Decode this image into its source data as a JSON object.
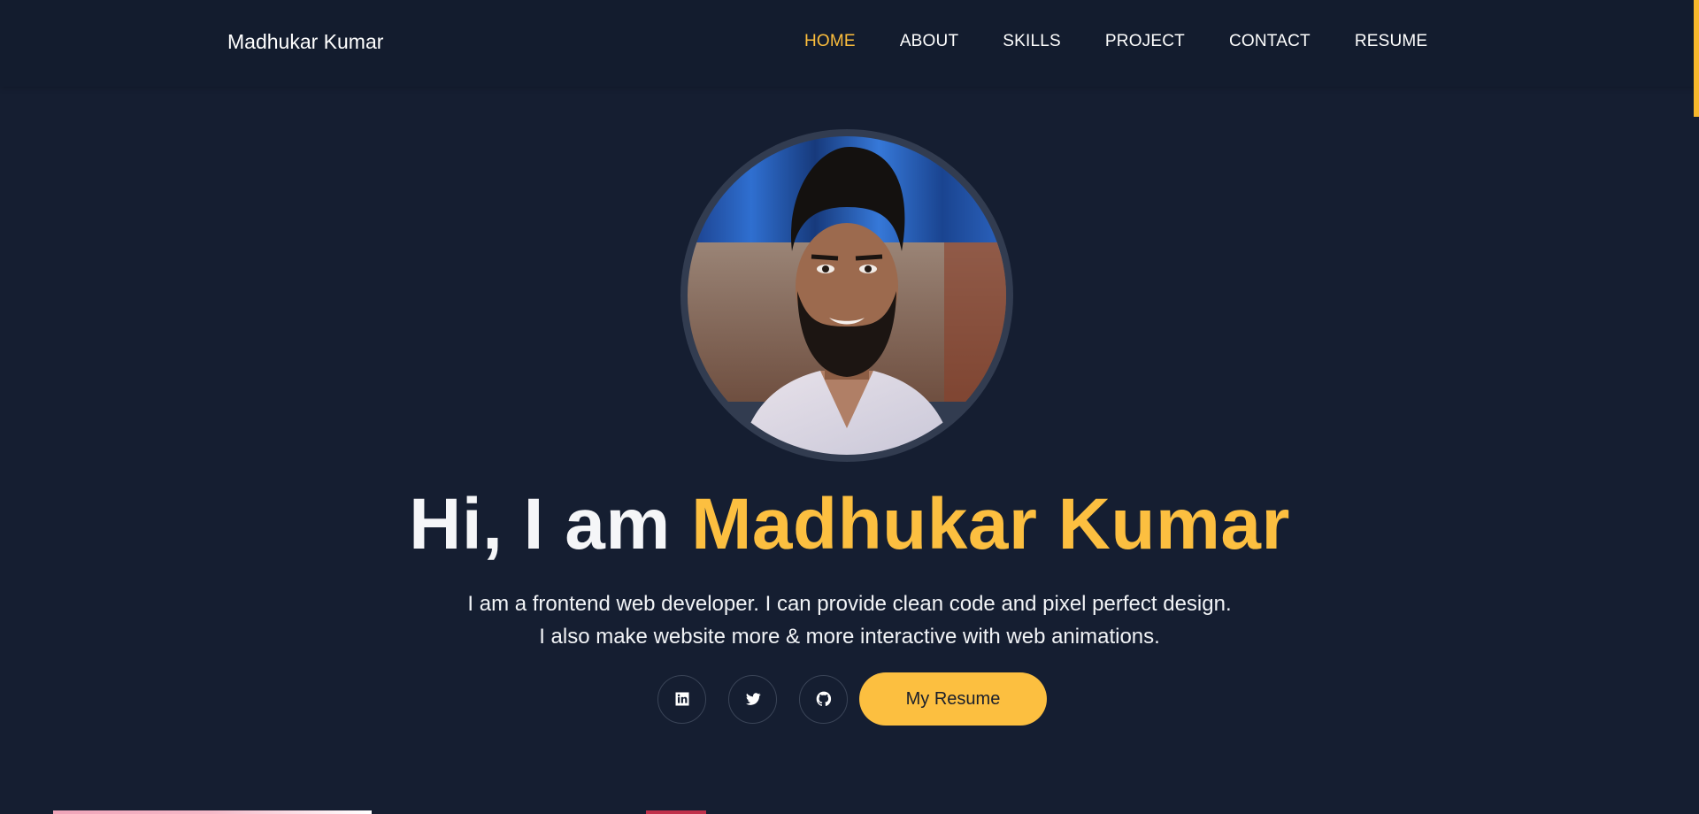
{
  "navbar": {
    "brand": "Madhukar Kumar",
    "links": [
      {
        "label": "HOME",
        "active": true
      },
      {
        "label": "ABOUT",
        "active": false
      },
      {
        "label": "SKILLS",
        "active": false
      },
      {
        "label": "PROJECT",
        "active": false
      },
      {
        "label": "CONTACT",
        "active": false
      },
      {
        "label": "RESUME",
        "active": false
      }
    ]
  },
  "hero": {
    "greeting": "Hi, I am",
    "name": "Madhukar Kumar",
    "description_line1": "I am a frontend web developer. I can provide clean code and pixel perfect design.",
    "description_line2": "I also make website more & more interactive with web animations.",
    "social_icons": [
      "linkedin-icon",
      "twitter-icon",
      "github-icon"
    ],
    "resume_button": "My Resume"
  },
  "colors": {
    "background": "#151e31",
    "accent": "#fcbf40",
    "text": "#ffffff"
  }
}
